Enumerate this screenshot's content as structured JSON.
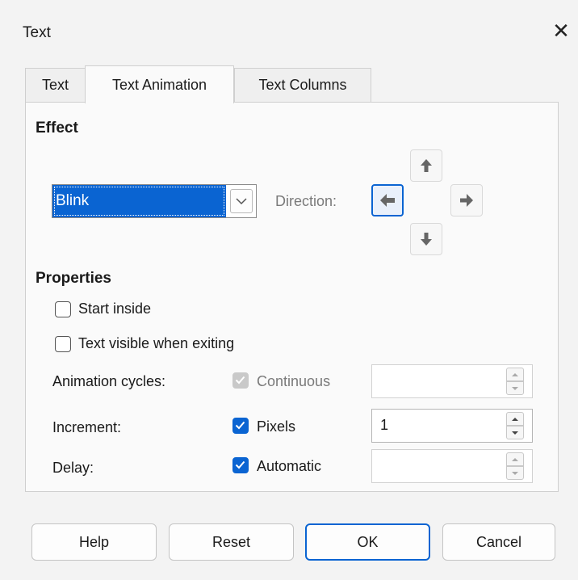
{
  "window": {
    "title": "Text",
    "close_glyph": "✕"
  },
  "tabs": [
    {
      "label": "Text",
      "active": false
    },
    {
      "label": "Text Animation",
      "active": true
    },
    {
      "label": "Text Columns",
      "active": false
    }
  ],
  "effect": {
    "heading": "Effect",
    "selected": "Blink",
    "direction_label": "Direction:",
    "direction_icons": [
      "arrow-up-icon",
      "arrow-left-icon",
      "arrow-right-icon",
      "arrow-down-icon"
    ],
    "active_direction": "left"
  },
  "properties": {
    "heading": "Properties",
    "start_inside": {
      "label": "Start inside",
      "checked": false
    },
    "text_visible": {
      "label": "Text visible when exiting",
      "checked": false
    },
    "rows": [
      {
        "label": "Animation cycles:",
        "check_label": "Continuous",
        "checked": true,
        "disabled": true,
        "value": ""
      },
      {
        "label": "Increment:",
        "check_label": "Pixels",
        "checked": true,
        "disabled": false,
        "value": "1"
      },
      {
        "label": "Delay:",
        "check_label": "Automatic",
        "checked": true,
        "disabled": false,
        "value": ""
      }
    ]
  },
  "buttons": {
    "help": "Help",
    "reset": "Reset",
    "ok": "OK",
    "cancel": "Cancel"
  },
  "colors": {
    "accent": "#0a64d2",
    "panel": "#fafafa",
    "window": "#f3f3f3"
  }
}
